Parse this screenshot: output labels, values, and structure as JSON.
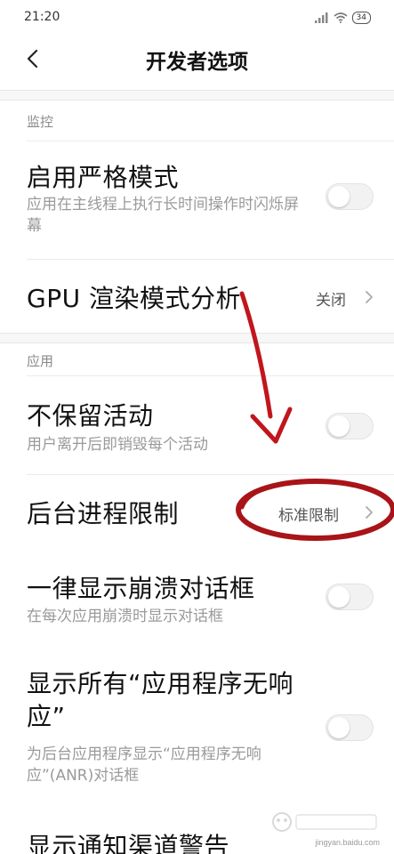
{
  "status_bar": {
    "time": "21:20",
    "battery": "34"
  },
  "header": {
    "title": "开发者选项"
  },
  "sections": {
    "monitor": {
      "label": "监控",
      "strict_mode": {
        "title": "启用严格模式",
        "subtitle": "应用在主线程上执行长时间操作时闪烁屏幕",
        "toggle_state": "off"
      },
      "gpu_render": {
        "title": "GPU 渲染模式分析",
        "value": "关闭"
      }
    },
    "apps": {
      "label": "应用",
      "dont_keep_activities": {
        "title": "不保留活动",
        "subtitle": "用户离开后即销毁每个活动",
        "toggle_state": "off"
      },
      "background_limit": {
        "title": "后台进程限制",
        "value": "标准限制"
      },
      "show_crash_dialog": {
        "title": "一律显示崩溃对话框",
        "subtitle": "在每次应用崩溃时显示对话框",
        "toggle_state": "off"
      },
      "show_all_anr": {
        "title": "显示所有“应用程序无响应”",
        "subtitle": "为后台应用程序显示“应用程序无响应”(ANR)对话框",
        "toggle_state": "off"
      },
      "notification_channel_warnings": {
        "title": "显示通知渠道警告"
      }
    }
  },
  "icons": {
    "back": "chevron-left-icon",
    "chevron": "chevron-right-icon",
    "signal": "signal-icon",
    "wifi": "wifi-icon",
    "battery": "battery-icon"
  },
  "annotation": {
    "arrow_color": "#c0161c",
    "circle_color": "#a81418"
  },
  "watermark": {
    "text": "jingyan.baidu.com"
  }
}
